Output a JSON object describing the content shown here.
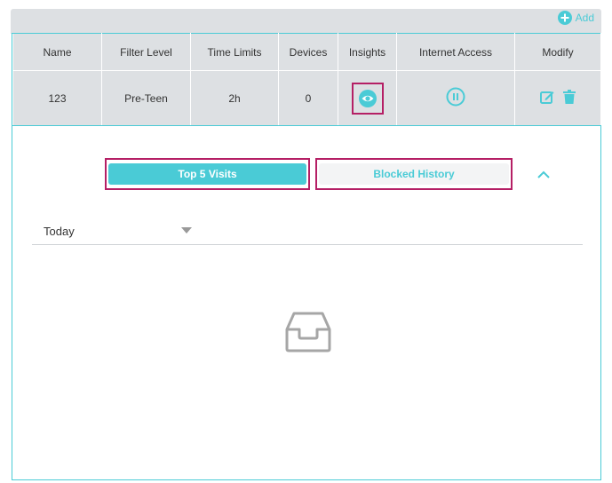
{
  "toolbar": {
    "add_label": "Add"
  },
  "table": {
    "headers": [
      "Name",
      "Filter Level",
      "Time Limits",
      "Devices",
      "Insights",
      "Internet Access",
      "Modify"
    ],
    "rows": [
      {
        "name": "123",
        "filter_level": "Pre-Teen",
        "time_limits": "2h",
        "devices": "0"
      }
    ]
  },
  "insights": {
    "tabs": [
      {
        "label": "Top 5 Visits",
        "active": true
      },
      {
        "label": "Blocked History",
        "active": false
      }
    ],
    "period": {
      "selected": "Today"
    }
  },
  "colors": {
    "accent": "#4acbd6",
    "highlight": "#b51f65",
    "header_bg": "#dde0e3"
  },
  "icons": [
    "add-circle-icon",
    "eye-icon",
    "pause-circle-icon",
    "edit-icon",
    "trash-icon",
    "chevron-up-icon",
    "empty-inbox-icon",
    "caret-down-icon"
  ]
}
